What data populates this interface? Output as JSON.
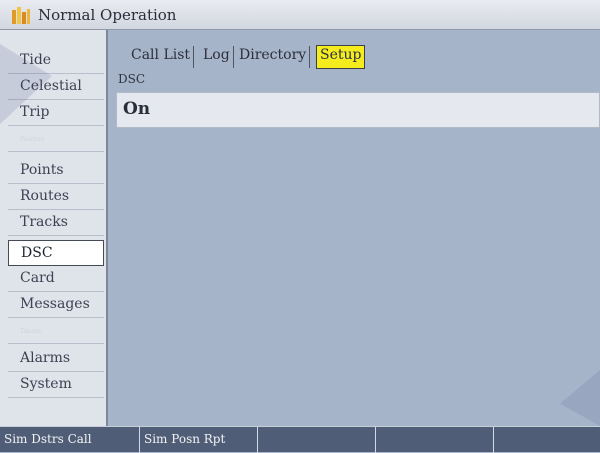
{
  "window": {
    "title": "Normal Operation"
  },
  "sidebar": {
    "items": [
      {
        "label": "Tide"
      },
      {
        "label": "Celestial"
      },
      {
        "label": "Trip"
      },
      {
        "label": "Position"
      },
      {
        "label": "Points"
      },
      {
        "label": "Routes"
      },
      {
        "label": "Tracks"
      },
      {
        "label": "DSC"
      },
      {
        "label": "Card"
      },
      {
        "label": "Messages"
      },
      {
        "label": "Timers"
      },
      {
        "label": "Alarms"
      },
      {
        "label": "System"
      }
    ],
    "selected": "DSC"
  },
  "tabs": [
    {
      "label": "Call List"
    },
    {
      "label": "Log"
    },
    {
      "label": "Directory"
    },
    {
      "label": "Setup"
    }
  ],
  "selected_tab": "Setup",
  "setup": {
    "field_label": "DSC",
    "field_value": "On"
  },
  "statusbar": {
    "cells": [
      {
        "label": "Sim Dstrs Call"
      },
      {
        "label": "Sim Posn Rpt"
      },
      {
        "label": ""
      },
      {
        "label": ""
      },
      {
        "label": ""
      }
    ]
  },
  "colors": {
    "background": "#a9b6cb",
    "sidebar": "#dfe3ea",
    "selected_tab": "#f4ec1d",
    "statusbar": "#4f5d76"
  }
}
